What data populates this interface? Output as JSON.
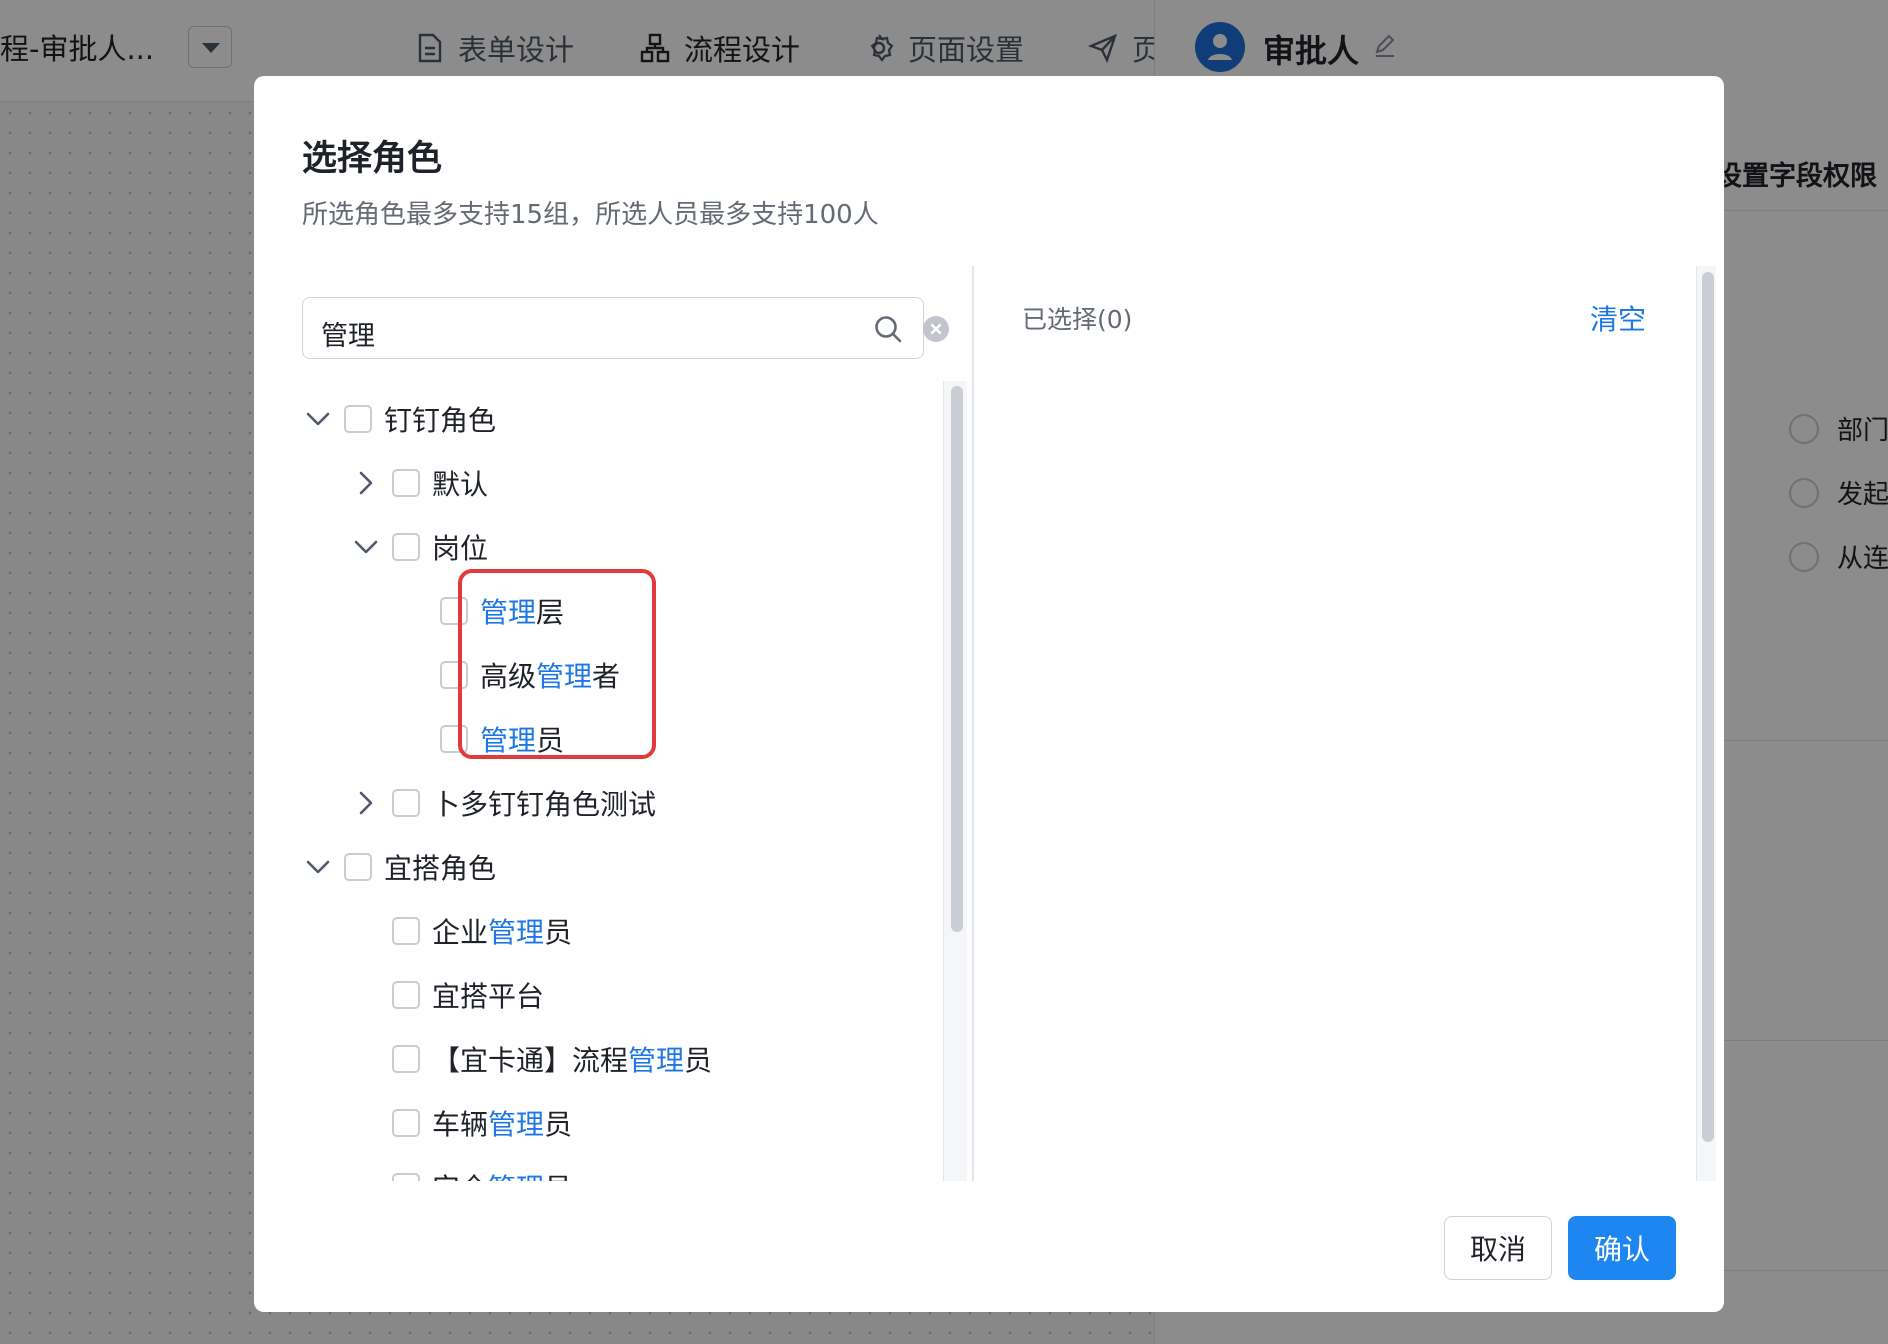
{
  "app": {
    "title": "程-审批人...",
    "tabs": [
      {
        "label": "表单设计",
        "icon": "document-icon"
      },
      {
        "label": "流程设计",
        "icon": "flow-icon"
      },
      {
        "label": "页面设置",
        "icon": "gear-icon"
      },
      {
        "label": "页",
        "icon": "send-icon"
      }
    ],
    "active_tab": "流程设计"
  },
  "right_panel": {
    "title": "审批人",
    "field_permission": "设置字段权限",
    "radio_options": [
      "部门",
      "发起",
      "从连"
    ]
  },
  "modal": {
    "title": "选择角色",
    "subtitle": "所选角色最多支持15组，所选人员最多支持100人",
    "search": {
      "value": "管理",
      "placeholder": ""
    },
    "selected_label": "已选择(0)",
    "clear_label": "清空",
    "cancel_label": "取消",
    "confirm_label": "确认",
    "tree": [
      {
        "pre": "钉钉角色",
        "hl": "",
        "post": "",
        "level": 0,
        "arrow": "down"
      },
      {
        "pre": "默认",
        "hl": "",
        "post": "",
        "level": 1,
        "arrow": "right"
      },
      {
        "pre": "岗位",
        "hl": "",
        "post": "",
        "level": 1,
        "arrow": "down"
      },
      {
        "pre": "",
        "hl": "管理",
        "post": "层",
        "level": 2,
        "arrow": "none"
      },
      {
        "pre": "高级",
        "hl": "管理",
        "post": "者",
        "level": 2,
        "arrow": "none"
      },
      {
        "pre": "",
        "hl": "管理",
        "post": "员",
        "level": 2,
        "arrow": "none"
      },
      {
        "pre": "卜多钉钉角色测试",
        "hl": "",
        "post": "",
        "level": 1,
        "arrow": "right"
      },
      {
        "pre": "宜搭角色",
        "hl": "",
        "post": "",
        "level": 0,
        "arrow": "down"
      },
      {
        "pre": "企业",
        "hl": "管理",
        "post": "员",
        "level": 1,
        "arrow": "none"
      },
      {
        "pre": "宜搭平台",
        "hl": "",
        "post": "",
        "level": 1,
        "arrow": "none"
      },
      {
        "pre": "【宜卡通】流程",
        "hl": "管理",
        "post": "员",
        "level": 1,
        "arrow": "none"
      },
      {
        "pre": "车辆",
        "hl": "管理",
        "post": "员",
        "level": 1,
        "arrow": "none"
      },
      {
        "pre": "安全",
        "hl": "管理",
        "post": "员",
        "level": 1,
        "arrow": "none"
      }
    ]
  },
  "colors": {
    "accent": "#1d86f0",
    "highlight_text": "#1d77e6",
    "annotation": "#e03a3a"
  }
}
